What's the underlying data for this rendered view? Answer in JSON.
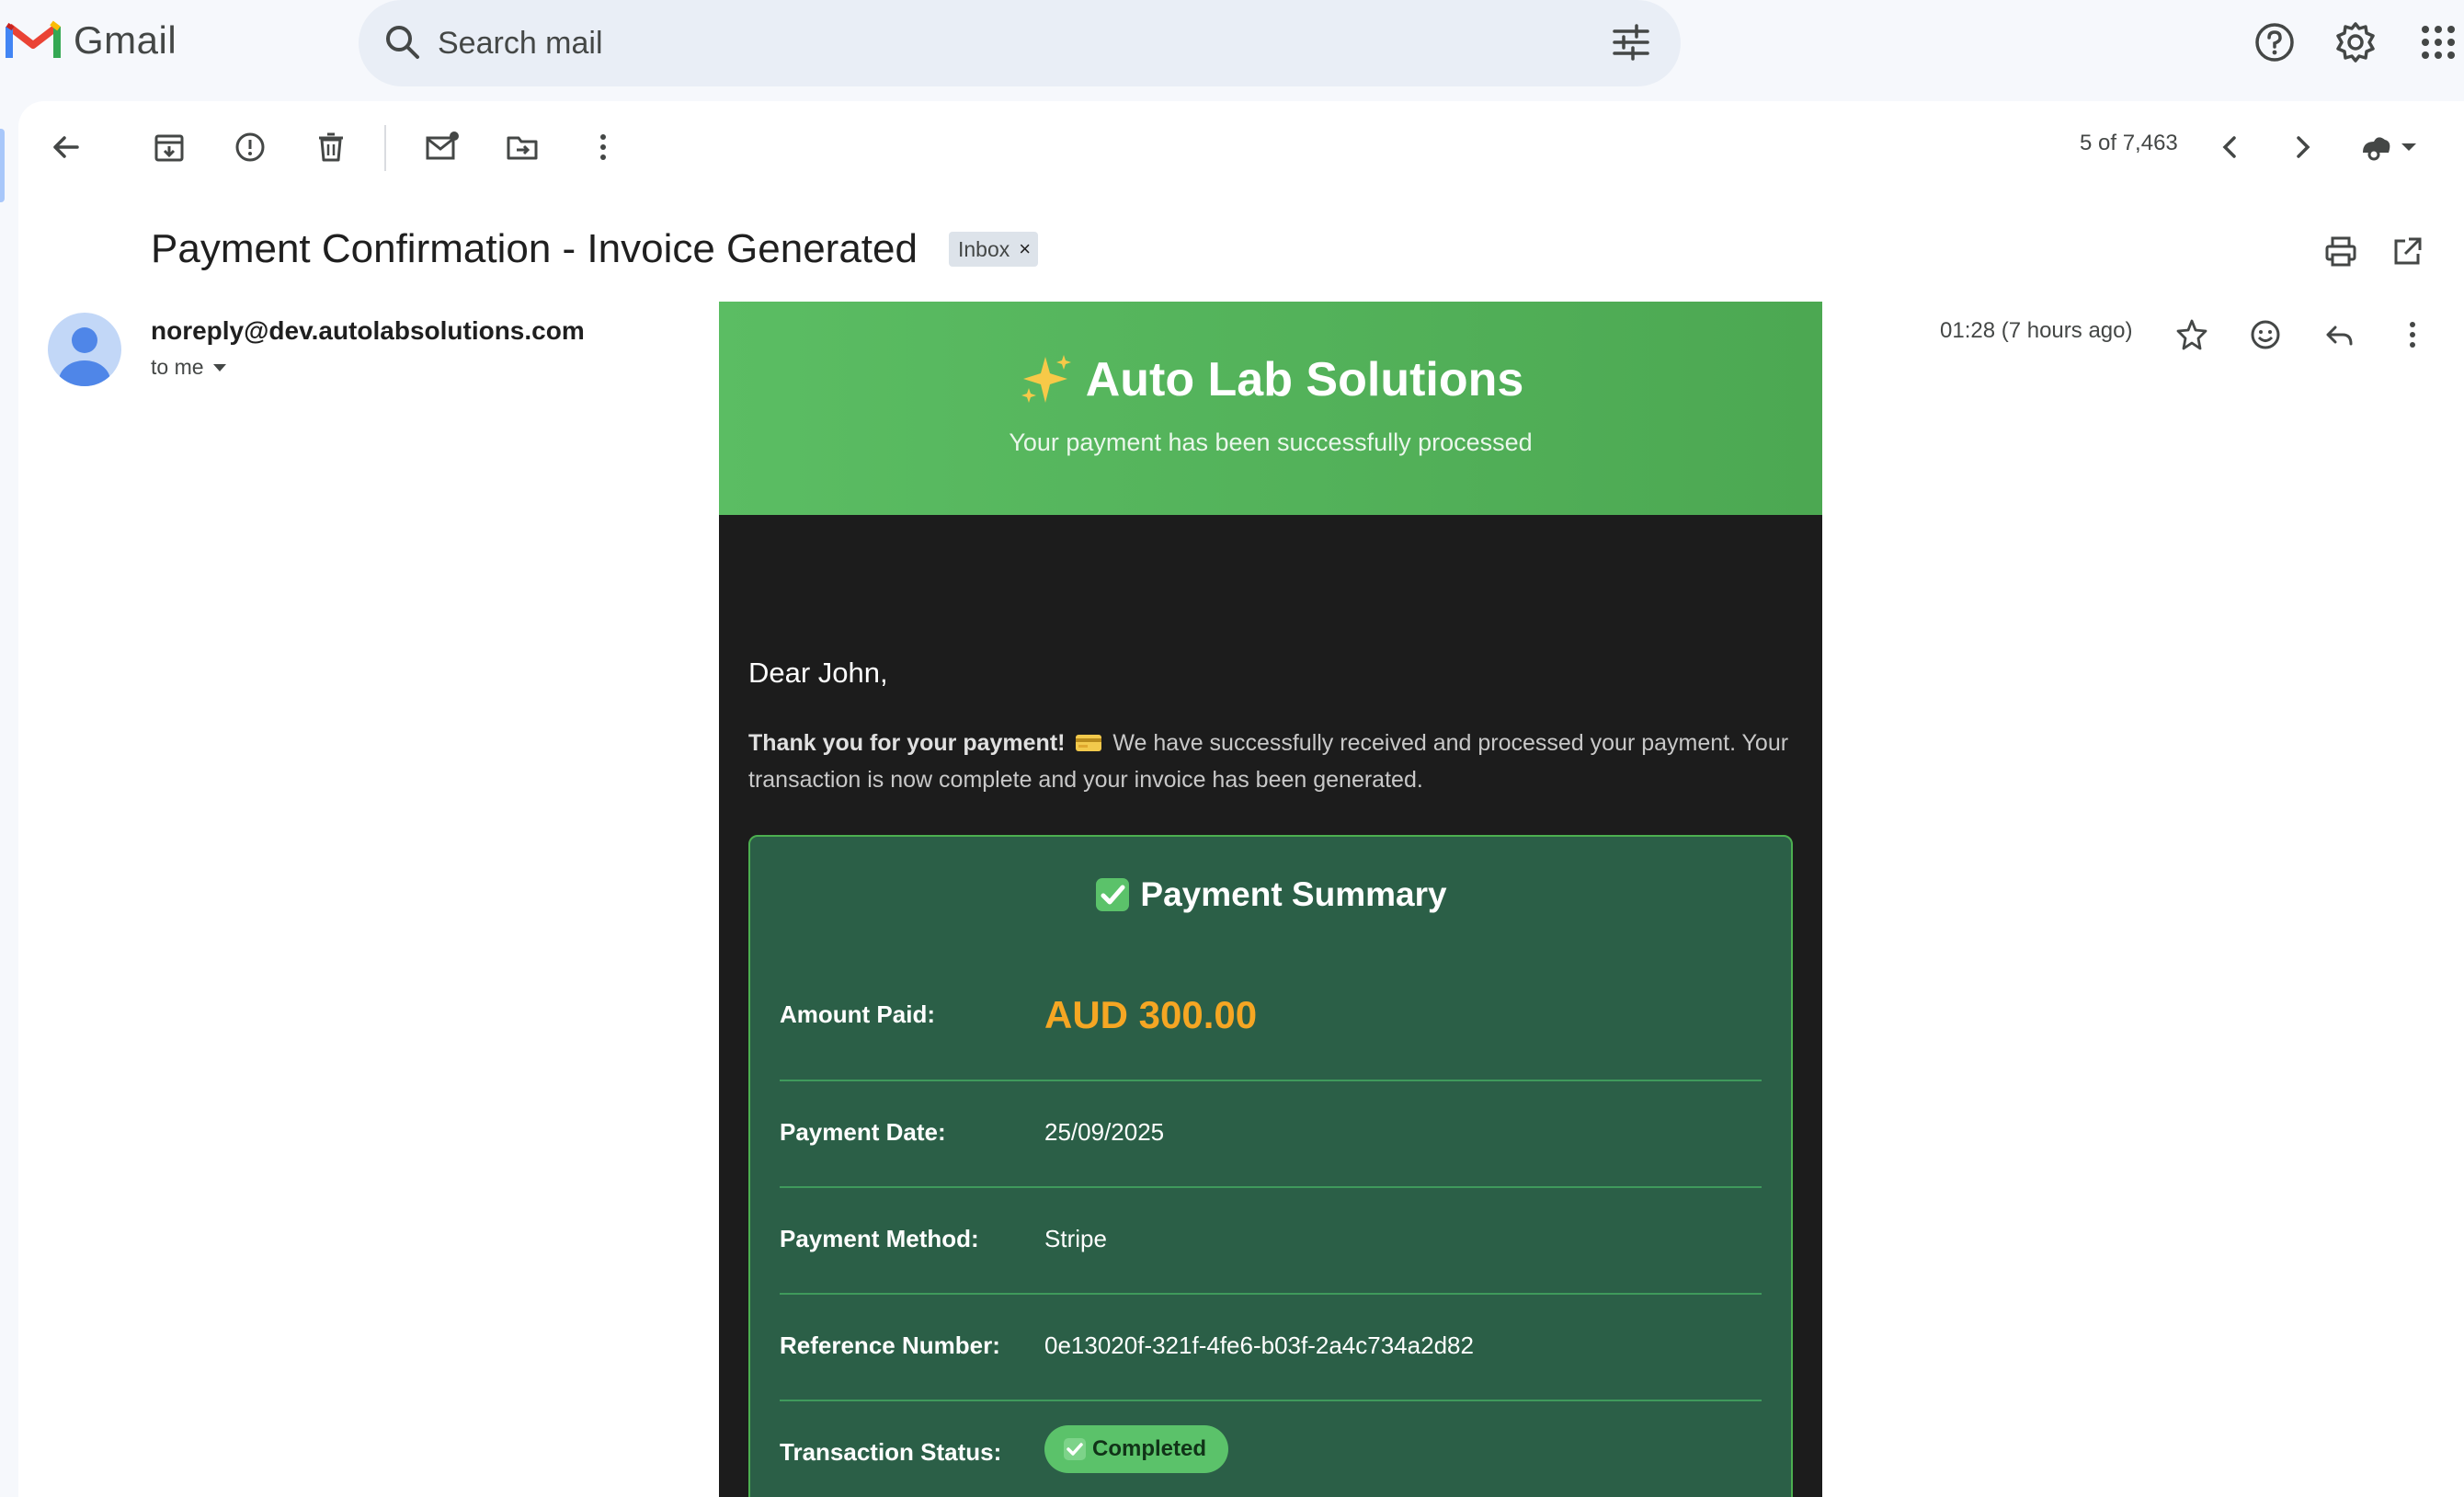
{
  "app": {
    "brand": "Gmail",
    "brand_colors": {
      "red": "#ea4335",
      "blue": "#4285f4",
      "green": "#34a853",
      "yellow": "#fbbc04"
    }
  },
  "search": {
    "placeholder": "Search mail"
  },
  "toolbar": {
    "pager": "5 of 7,463"
  },
  "message": {
    "subject": "Payment Confirmation - Invoice Generated",
    "label_chip": "Inbox",
    "label_chip_close": "×",
    "sender": "noreply@dev.autolabsolutions.com",
    "recipient": "to me",
    "time": "01:28 (7 hours ago)"
  },
  "email_body": {
    "hero_title": "Auto Lab Solutions",
    "hero_subtitle": "Your payment has been successfully processed",
    "greeting": "Dear John,",
    "intro_bold": "Thank you for your payment!",
    "intro_rest": "We have successfully received and processed your payment. Your transaction is now complete and your invoice has been generated.",
    "summary_title": "Payment Summary",
    "rows": [
      {
        "label": "Amount Paid:",
        "value": "AUD 300.00"
      },
      {
        "label": "Payment Date:",
        "value": "25/09/2025"
      },
      {
        "label": "Payment Method:",
        "value": "Stripe"
      },
      {
        "label": "Reference Number:",
        "value": "0e13020f-321f-4fe6-b03f-2a4c734a2d82"
      },
      {
        "label": "Transaction Status:",
        "value": "Completed"
      }
    ],
    "colors": {
      "header_green": "#5bbd63",
      "summary_bg": "#2b5f47",
      "amount_orange": "#f5a623",
      "body_bg": "#1c1c1c"
    }
  },
  "icons": [
    "gmail-logo-icon",
    "search-icon",
    "filter-options-icon",
    "help-icon",
    "settings-icon",
    "apps-grid-icon",
    "back-arrow-icon",
    "archive-icon",
    "report-spam-icon",
    "delete-icon",
    "mark-unread-icon",
    "move-to-icon",
    "more-vert-icon",
    "chevron-left-icon",
    "chevron-right-icon",
    "input-tools-icon",
    "print-icon",
    "open-in-new-window-icon",
    "star-icon",
    "emoji-react-icon",
    "reply-icon",
    "sparkles-icon",
    "credit-card-icon",
    "check-mark-icon"
  ]
}
